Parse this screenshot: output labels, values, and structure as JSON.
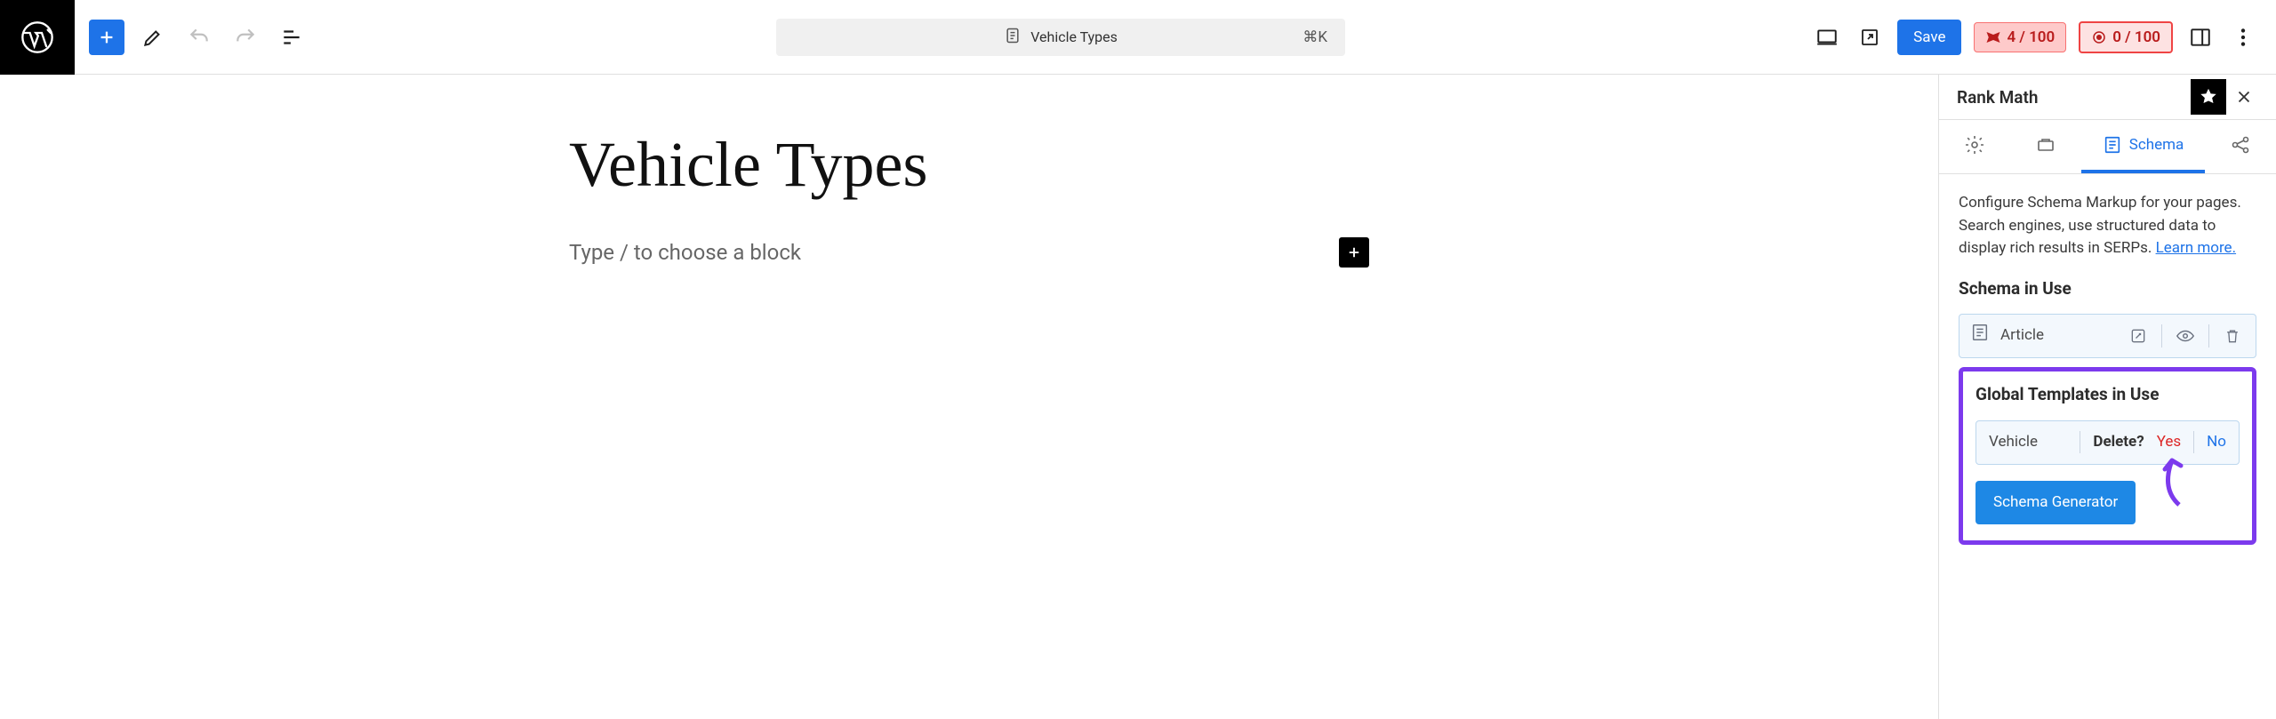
{
  "topbar": {
    "title": "Vehicle Types",
    "shortcut": "⌘K",
    "save_label": "Save",
    "score1": "4 / 100",
    "score2": "0 / 100"
  },
  "editor": {
    "page_title": "Vehicle Types",
    "block_prompt": "Type / to choose a block"
  },
  "sidebar": {
    "title": "Rank Math",
    "tabs": {
      "schema": "Schema"
    },
    "desc1": "Configure Schema Markup for your pages. Search engines, use structured data to display rich results in SERPs.",
    "learn_more": "Learn more.",
    "section_schema_in_use": "Schema in Use",
    "article_label": "Article",
    "section_global_templates": "Global Templates in Use",
    "template_name": "Vehicle",
    "delete_label": "Delete?",
    "yes_label": "Yes",
    "no_label": "No",
    "generator_btn": "Schema Generator"
  }
}
